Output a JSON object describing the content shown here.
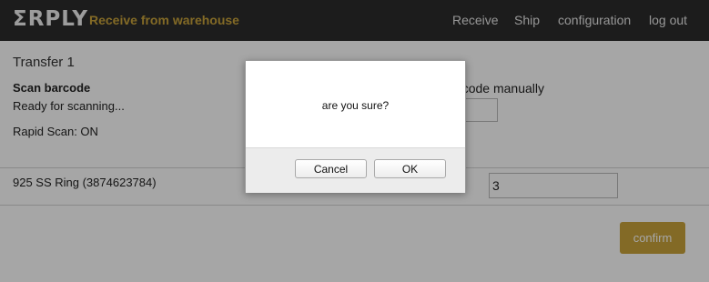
{
  "header": {
    "logo": "ΣRPLY",
    "page_title": "Receive from warehouse",
    "nav": [
      "Receive",
      "Ship",
      "configuration",
      "log out"
    ]
  },
  "main": {
    "transfer_title": "Transfer 1",
    "scan_title": "Scan barcode",
    "scan_status": "Ready for scanning...",
    "rapid_scan": "Rapid Scan: ON",
    "manual_label": "or enter product code manually",
    "manual_value": "",
    "items": [
      {
        "name": "925 SS Ring (3874623784)",
        "quantity": "3"
      }
    ],
    "confirm_label": "confirm"
  },
  "dialog": {
    "message": "are you sure?",
    "cancel_label": "Cancel",
    "ok_label": "OK"
  },
  "colors": {
    "accent": "#c9a43b",
    "topbar": "#2b2b2b"
  }
}
